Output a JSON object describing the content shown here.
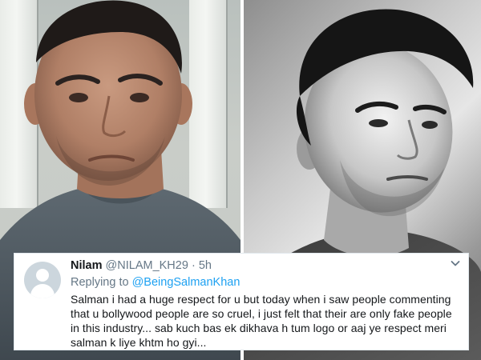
{
  "tweet": {
    "display_name": "Nilam",
    "handle": "@NILAM_KH29",
    "separator": "·",
    "time": "5h",
    "replying_label": "Replying to",
    "replying_handle": "@BeingSalmanKhan",
    "text": "Salman i had a huge respect for u but today when i saw people commenting that u bollywood people are so cruel, i just felt that their are only fake people in this industry... sab kuch bas ek dikhava h tum logo or aaj ye respect meri salman k liye khtm ho gyi..."
  },
  "colors": {
    "name_text": "#14171a",
    "secondary_text": "#657786",
    "link": "#1da1f2",
    "card_border": "#e1e8ed",
    "avatar_bg": "#ccd6dd"
  },
  "icons": {
    "avatar": "default-avatar-icon",
    "menu": "chevron-down-icon"
  }
}
